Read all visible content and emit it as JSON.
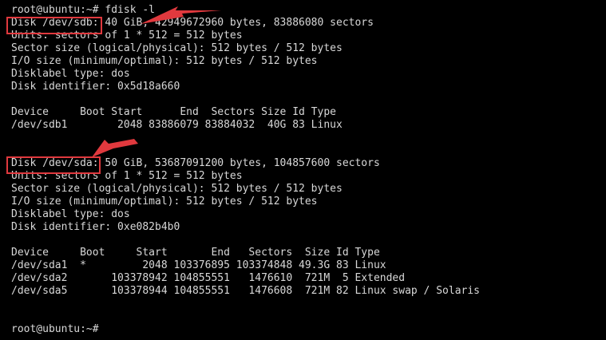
{
  "terminal": {
    "lines": [
      "root@ubuntu:~# fdisk -l",
      "Disk /dev/sdb: 40 GiB, 42949672960 bytes, 83886080 sectors",
      "Units: sectors of 1 * 512 = 512 bytes",
      "Sector size (logical/physical): 512 bytes / 512 bytes",
      "I/O size (minimum/optimal): 512 bytes / 512 bytes",
      "Disklabel type: dos",
      "Disk identifier: 0x5d18a660",
      "",
      "Device     Boot Start      End  Sectors Size Id Type",
      "/dev/sdb1        2048 83886079 83884032  40G 83 Linux",
      "",
      "",
      "Disk /dev/sda: 50 GiB, 53687091200 bytes, 104857600 sectors",
      "Units: sectors of 1 * 512 = 512 bytes",
      "Sector size (logical/physical): 512 bytes / 512 bytes",
      "I/O size (minimum/optimal): 512 bytes / 512 bytes",
      "Disklabel type: dos",
      "Disk identifier: 0xe082b4b0",
      "",
      "Device     Boot     Start       End   Sectors  Size Id Type",
      "/dev/sda1  *         2048 103376895 103374848 49.3G 83 Linux",
      "/dev/sda2       103378942 104855551   1476610  721M  5 Extended",
      "/dev/sda5       103378944 104855551   1476608  721M 82 Linux swap / Solaris",
      "",
      "",
      "root@ubuntu:~#"
    ]
  },
  "annotation": {
    "color": "#e0393e"
  }
}
